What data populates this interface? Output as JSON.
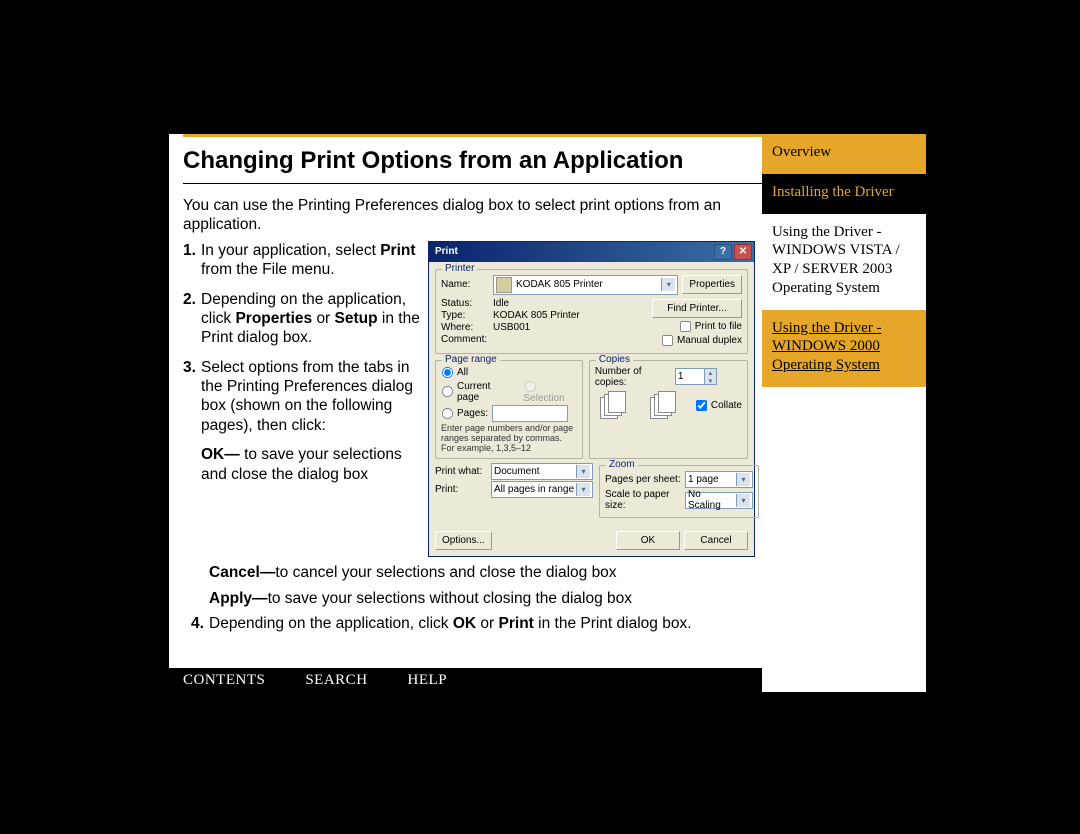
{
  "page": {
    "title": "Changing Print Options from an Application",
    "intro": "You can use the Printing Preferences dialog box to select print options from an application.",
    "steps": {
      "s1_pre": "In your application, select ",
      "s1_b": "Print",
      "s1_post": " from the File menu.",
      "s2_pre": "Depending on the application, click ",
      "s2_b": "Properties",
      "s2_mid": " or ",
      "s2_b2": "Setup",
      "s2_post": " in the Print dialog box.",
      "s3": "Select options from the tabs in the Printing Preferences dialog box (shown on the following pages), then click:",
      "ok_b": "OK—",
      "ok_t": "to save your selections and close the dialog box",
      "cancel_b": "Cancel—",
      "cancel_t": "to cancel your selections and close the dialog box",
      "apply_b": "Apply—",
      "apply_t": "to save your selections without closing the dialog box",
      "s4_pre": "Depending on the application, click ",
      "s4_b1": "OK",
      "s4_mid": " or ",
      "s4_b2": "Print",
      "s4_post": " in the Print dialog box."
    },
    "nums": {
      "n1": "1.",
      "n2": "2.",
      "n3": "3.",
      "n4": "4."
    }
  },
  "sidebar": {
    "overview": "Overview",
    "installing": "Installing the Driver",
    "vista": "Using the Driver - WINDOWS VISTA / XP / SERVER 2003 Operating System",
    "w2000": "Using the Driver - WINDOWS 2000 Operating System"
  },
  "nav": {
    "contents": "CONTENTS",
    "search": "SEARCH",
    "help": "HELP"
  },
  "dlg": {
    "title": "Print",
    "grp_printer": "Printer",
    "name": "Name:",
    "printer_name": "KODAK 805 Printer",
    "status": "Status:",
    "status_v": "Idle",
    "type": "Type:",
    "type_v": "KODAK 805 Printer",
    "where": "Where:",
    "where_v": "USB001",
    "comment": "Comment:",
    "properties": "Properties",
    "find_printer": "Find Printer...",
    "print_to_file": "Print to file",
    "manual_duplex": "Manual duplex",
    "grp_range": "Page range",
    "all": "All",
    "current": "Current page",
    "selection": "Selection",
    "pages": "Pages:",
    "range_hint": "Enter page numbers and/or page ranges separated by commas. For example, 1,3,5–12",
    "grp_copies": "Copies",
    "num_copies": "Number of copies:",
    "copies_v": "1",
    "collate": "Collate",
    "print_what": "Print what:",
    "print_what_v": "Document",
    "print": "Print:",
    "print_v": "All pages in range",
    "grp_zoom": "Zoom",
    "pps": "Pages per sheet:",
    "pps_v": "1 page",
    "scale": "Scale to paper size:",
    "scale_v": "No Scaling",
    "options": "Options...",
    "ok": "OK",
    "cancel": "Cancel"
  }
}
